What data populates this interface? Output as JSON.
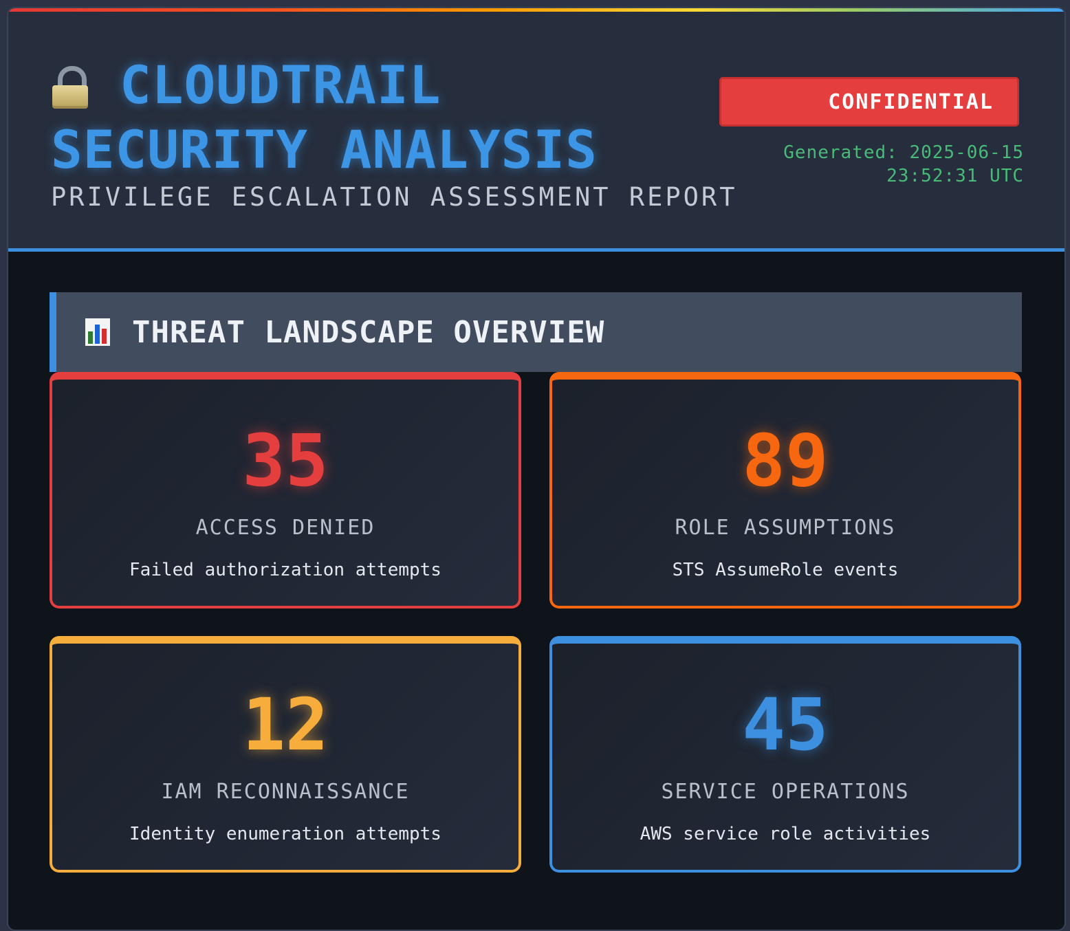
{
  "header": {
    "title": "CLOUDTRAIL SECURITY ANALYSIS",
    "subtitle": "PRIVILEGE ESCALATION ASSESSMENT REPORT",
    "badge": "CONFIDENTIAL",
    "generated_date": "Generated: 2025-06-15",
    "generated_time": "23:52:31 UTC",
    "title_icon": "lock-icon"
  },
  "section": {
    "title": "THREAT LANDSCAPE OVERVIEW",
    "icon": "bar-chart-icon"
  },
  "cards": [
    {
      "value": "35",
      "label": "ACCESS DENIED",
      "description": "Failed authorization attempts",
      "color": "#e53e3e"
    },
    {
      "value": "89",
      "label": "ROLE ASSUMPTIONS",
      "description": "STS AssumeRole events",
      "color": "#f6670f"
    },
    {
      "value": "12",
      "label": "IAM RECONNAISSANCE",
      "description": "Identity enumeration attempts",
      "color": "#f6ad3b"
    },
    {
      "value": "45",
      "label": "SERVICE OPERATIONS",
      "description": "AWS service role activities",
      "color": "#3d8fe0"
    }
  ],
  "colors": {
    "accent": "#3d8fe0",
    "confidential": "#e53e3e",
    "generated_text": "#48bb78"
  }
}
